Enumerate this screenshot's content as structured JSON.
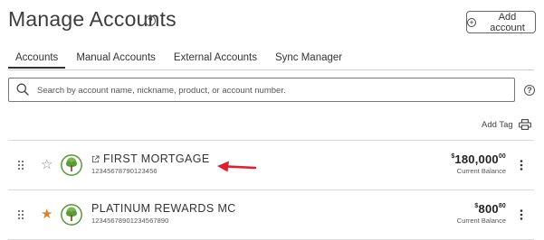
{
  "header": {
    "title": "Manage Accounts",
    "help_glyph": "?",
    "add_account_label": "Add account"
  },
  "tabs": [
    {
      "label": "Accounts",
      "active": true
    },
    {
      "label": "Manual Accounts",
      "active": false
    },
    {
      "label": "External Accounts",
      "active": false
    },
    {
      "label": "Sync Manager",
      "active": false
    }
  ],
  "search": {
    "placeholder": "Search by account name, nickname, product, or account number.",
    "help_glyph": "?"
  },
  "toolbar": {
    "add_tag_label": "Add Tag"
  },
  "accounts": [
    {
      "name": "FIRST MORTGAGE",
      "number": "12345678790123456",
      "favorite": false,
      "external_link": true,
      "balance_symbol": "$",
      "balance_whole": "180,000",
      "balance_cents": "00",
      "balance_label": "Current Balance"
    },
    {
      "name": "PLATINUM REWARDS MC",
      "number": "12345678901234567890",
      "favorite": true,
      "external_link": false,
      "balance_symbol": "$",
      "balance_whole": "800",
      "balance_cents": "80",
      "balance_label": "Current Balance"
    }
  ],
  "icons": {
    "help": "help-icon",
    "add": "plus-circle-icon",
    "search": "search-icon",
    "print": "printer-icon",
    "drag": "drag-handle-icon",
    "star_empty": "star-outline-icon",
    "star_filled": "star-filled-icon",
    "external": "external-link-icon",
    "more": "more-vertical-icon",
    "annotation": "red-arrow-icon"
  },
  "colors": {
    "star_filled": "#d9822b",
    "annotation_arrow": "#e0202e",
    "logo_green": "#5a9a3a"
  }
}
